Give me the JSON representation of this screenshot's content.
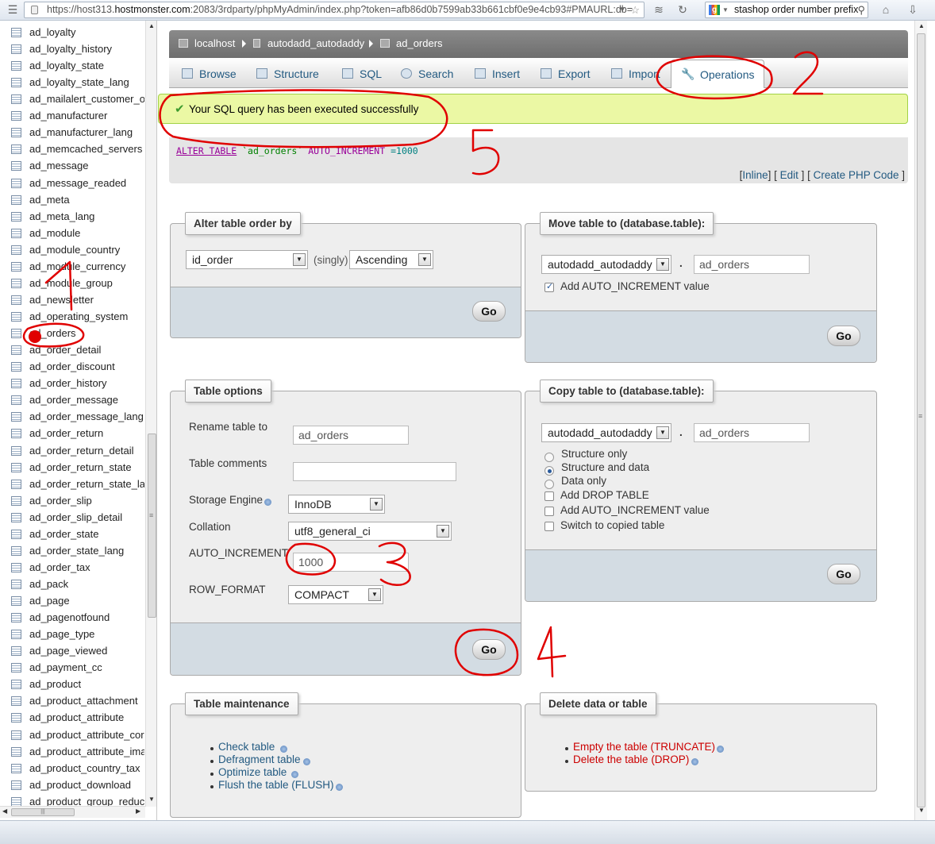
{
  "browser": {
    "url_prefix": "https://host313.",
    "url_host": "hostmonster.com",
    "url_rest": ":2083/3rdparty/phpMyAdmin/index.php?token=afb86d0b7599ab33b661cbf0e9e4cb93#PMAURL:db=",
    "search_text": "stashop order number prefix"
  },
  "sidebar": {
    "tables": [
      "ad_loyalty",
      "ad_loyalty_history",
      "ad_loyalty_state",
      "ad_loyalty_state_lang",
      "ad_mailalert_customer_o",
      "ad_manufacturer",
      "ad_manufacturer_lang",
      "ad_memcached_servers",
      "ad_message",
      "ad_message_readed",
      "ad_meta",
      "ad_meta_lang",
      "ad_module",
      "ad_module_country",
      "ad_module_currency",
      "ad_module_group",
      "ad_newsletter",
      "ad_operating_system",
      "ad_orders",
      "ad_order_detail",
      "ad_order_discount",
      "ad_order_history",
      "ad_order_message",
      "ad_order_message_lang",
      "ad_order_return",
      "ad_order_return_detail",
      "ad_order_return_state",
      "ad_order_return_state_la",
      "ad_order_slip",
      "ad_order_slip_detail",
      "ad_order_state",
      "ad_order_state_lang",
      "ad_order_tax",
      "ad_pack",
      "ad_page",
      "ad_pagenotfound",
      "ad_page_type",
      "ad_page_viewed",
      "ad_payment_cc",
      "ad_product",
      "ad_product_attachment",
      "ad_product_attribute",
      "ad_product_attribute_cor",
      "ad_product_attribute_ima",
      "ad_product_country_tax",
      "ad_product_download",
      "ad_product_group_reduct"
    ]
  },
  "breadcrumb": {
    "server": "localhost",
    "database": "autodadd_autodaddy",
    "table": "ad_orders"
  },
  "tabs": [
    "Browse",
    "Structure",
    "SQL",
    "Search",
    "Insert",
    "Export",
    "Import",
    "Operations"
  ],
  "active_tab": "Operations",
  "success_message": "Your SQL query has been executed successfully",
  "sql": {
    "kw1": "ALTER TABLE",
    "ident": "`ad_orders`",
    "kw2": "AUTO_INCREMENT",
    "eq": "=",
    "num": "1000"
  },
  "sql_links": {
    "inline": "Inline",
    "edit": "Edit",
    "create_php": "Create PHP Code"
  },
  "alter_order": {
    "legend": "Alter table order by",
    "column": "id_order",
    "singly": "(singly)",
    "direction": "Ascending",
    "go": "Go"
  },
  "move_table": {
    "legend": "Move table to (database.table):",
    "database": "autodadd_autodaddy",
    "dot": ".",
    "table": "ad_orders",
    "auto_increment_label": "Add AUTO_INCREMENT value",
    "go": "Go"
  },
  "table_options": {
    "legend": "Table options",
    "rename_label": "Rename table to",
    "rename_value": "ad_orders",
    "comments_label": "Table comments",
    "comments_value": "",
    "engine_label": "Storage Engine",
    "engine_value": "InnoDB",
    "collation_label": "Collation",
    "collation_value": "utf8_general_ci",
    "auto_increment_label": "AUTO_INCREMENT",
    "auto_increment_value": "1000",
    "row_format_label": "ROW_FORMAT",
    "row_format_value": "COMPACT",
    "go": "Go"
  },
  "copy_table": {
    "legend": "Copy table to (database.table):",
    "database": "autodadd_autodaddy",
    "dot": ".",
    "table": "ad_orders",
    "structure_only": "Structure only",
    "structure_and_data": "Structure and data",
    "data_only": "Data only",
    "add_drop": "Add DROP TABLE",
    "add_auto_increment": "Add AUTO_INCREMENT value",
    "switch_to_copied": "Switch to copied table",
    "go": "Go"
  },
  "maintenance": {
    "legend": "Table maintenance",
    "links": [
      "Check table",
      "Defragment table",
      "Optimize table",
      "Flush the table (FLUSH)"
    ]
  },
  "delete": {
    "legend": "Delete data or table",
    "links": [
      "Empty the table (TRUNCATE)",
      "Delete the table (DROP)"
    ]
  },
  "annotations": [
    "1",
    "2",
    "3",
    "4",
    "5"
  ]
}
